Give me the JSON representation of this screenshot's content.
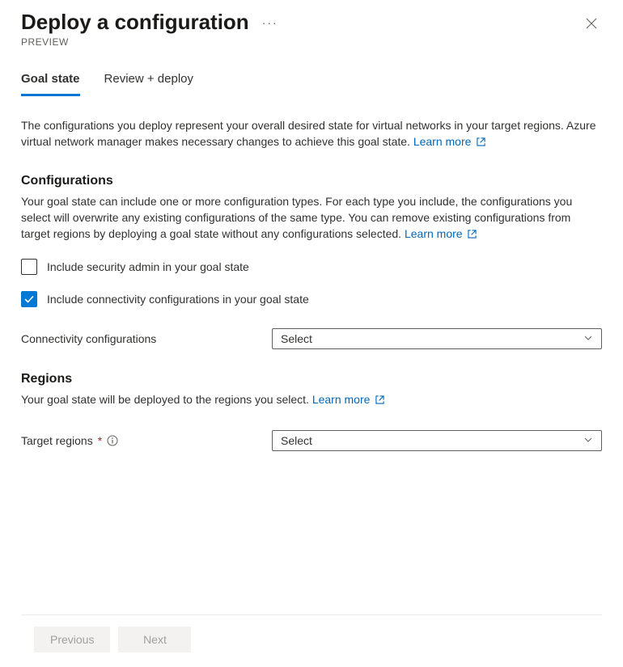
{
  "header": {
    "title": "Deploy a configuration",
    "subtitle": "PREVIEW"
  },
  "tabs": {
    "goal_state": "Goal state",
    "review_deploy": "Review + deploy"
  },
  "intro": {
    "text": "The configurations you deploy represent your overall desired state for virtual networks in your target regions. Azure virtual network manager makes necessary changes to achieve this goal state.",
    "learn_more": "Learn more"
  },
  "configurations": {
    "heading": "Configurations",
    "desc": "Your goal state can include one or more configuration types. For each type you include, the configurations you select will overwrite any existing configurations of the same type. You can remove existing configurations from target regions by deploying a goal state without any configurations selected.",
    "learn_more": "Learn more",
    "include_security_admin": "Include security admin in your goal state",
    "include_connectivity": "Include connectivity configurations in your goal state",
    "connectivity_label": "Connectivity configurations",
    "connectivity_value": "Select"
  },
  "regions": {
    "heading": "Regions",
    "desc": "Your goal state will be deployed to the regions you select.",
    "learn_more": "Learn more",
    "target_regions_label": "Target regions",
    "target_regions_value": "Select"
  },
  "footer": {
    "previous": "Previous",
    "next": "Next"
  }
}
